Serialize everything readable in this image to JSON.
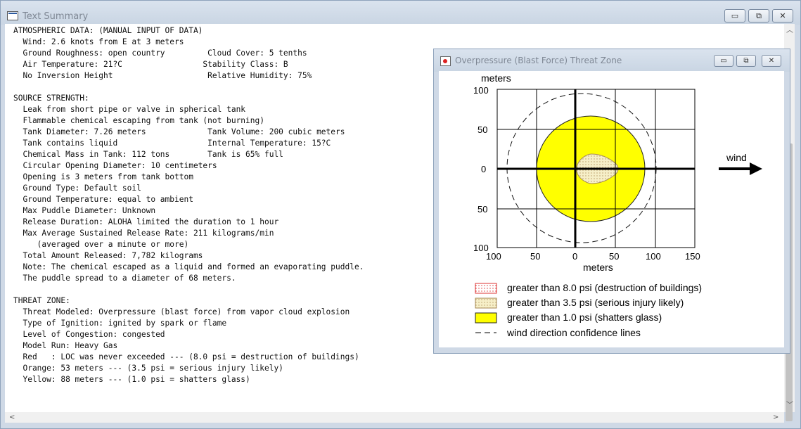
{
  "window": {
    "title": "Text Summary",
    "minimize": "▭",
    "restore": "⧉",
    "close": "✕"
  },
  "summary_lines": [
    "ATMOSPHERIC DATA: (MANUAL INPUT OF DATA)",
    "  Wind: 2.6 knots from E at 3 meters",
    "  Ground Roughness: open country         Cloud Cover: 5 tenths",
    "  Air Temperature: 21?C                 Stability Class: B",
    "  No Inversion Height                    Relative Humidity: 75%",
    "",
    "SOURCE STRENGTH:",
    "  Leak from short pipe or valve in spherical tank",
    "  Flammable chemical escaping from tank (not burning)",
    "  Tank Diameter: 7.26 meters             Tank Volume: 200 cubic meters",
    "  Tank contains liquid                   Internal Temperature: 15?C",
    "  Chemical Mass in Tank: 112 tons        Tank is 65% full",
    "  Circular Opening Diameter: 10 centimeters",
    "  Opening is 3 meters from tank bottom",
    "  Ground Type: Default soil",
    "  Ground Temperature: equal to ambient",
    "  Max Puddle Diameter: Unknown",
    "  Release Duration: ALOHA limited the duration to 1 hour",
    "  Max Average Sustained Release Rate: 211 kilograms/min",
    "     (averaged over a minute or more)",
    "  Total Amount Released: 7,782 kilograms",
    "  Note: The chemical escaped as a liquid and formed an evaporating puddle.",
    "  The puddle spread to a diameter of 68 meters.",
    "",
    "THREAT ZONE:",
    "  Threat Modeled: Overpressure (blast force) from vapor cloud explosion",
    "  Type of Ignition: ignited by spark or flame",
    "  Level of Congestion: congested",
    "  Model Run: Heavy Gas",
    "  Red   : LOC was never exceeded --- (8.0 psi = destruction of buildings)",
    "  Orange: 53 meters --- (3.5 psi = serious injury likely)",
    "  Yellow: 88 meters --- (1.0 psi = shatters glass)"
  ],
  "threat_window": {
    "title": "Overpressure (Blast Force) Threat Zone",
    "minimize": "▭",
    "restore": "⧉",
    "close": "✕"
  },
  "plot": {
    "ylabel": "meters",
    "xlabel": "meters",
    "wind_label": "wind",
    "x_ticks": [
      "100",
      "50",
      "0",
      "50",
      "100",
      "150"
    ],
    "y_ticks": [
      "100",
      "50",
      "0",
      "50",
      "100"
    ],
    "colors": {
      "yellow": "#ffff00",
      "orange_fill": "#f6efc8",
      "red_fill": "#ffffff"
    }
  },
  "legend": [
    {
      "label": "greater than 8.0 psi (destruction of buildings)",
      "swatch": "red"
    },
    {
      "label": "greater than 3.5 psi (serious injury likely)",
      "swatch": "orange"
    },
    {
      "label": "greater than 1.0 psi (shatters glass)",
      "swatch": "yellow"
    },
    {
      "label": "wind direction confidence lines",
      "swatch": "dash"
    }
  ]
}
